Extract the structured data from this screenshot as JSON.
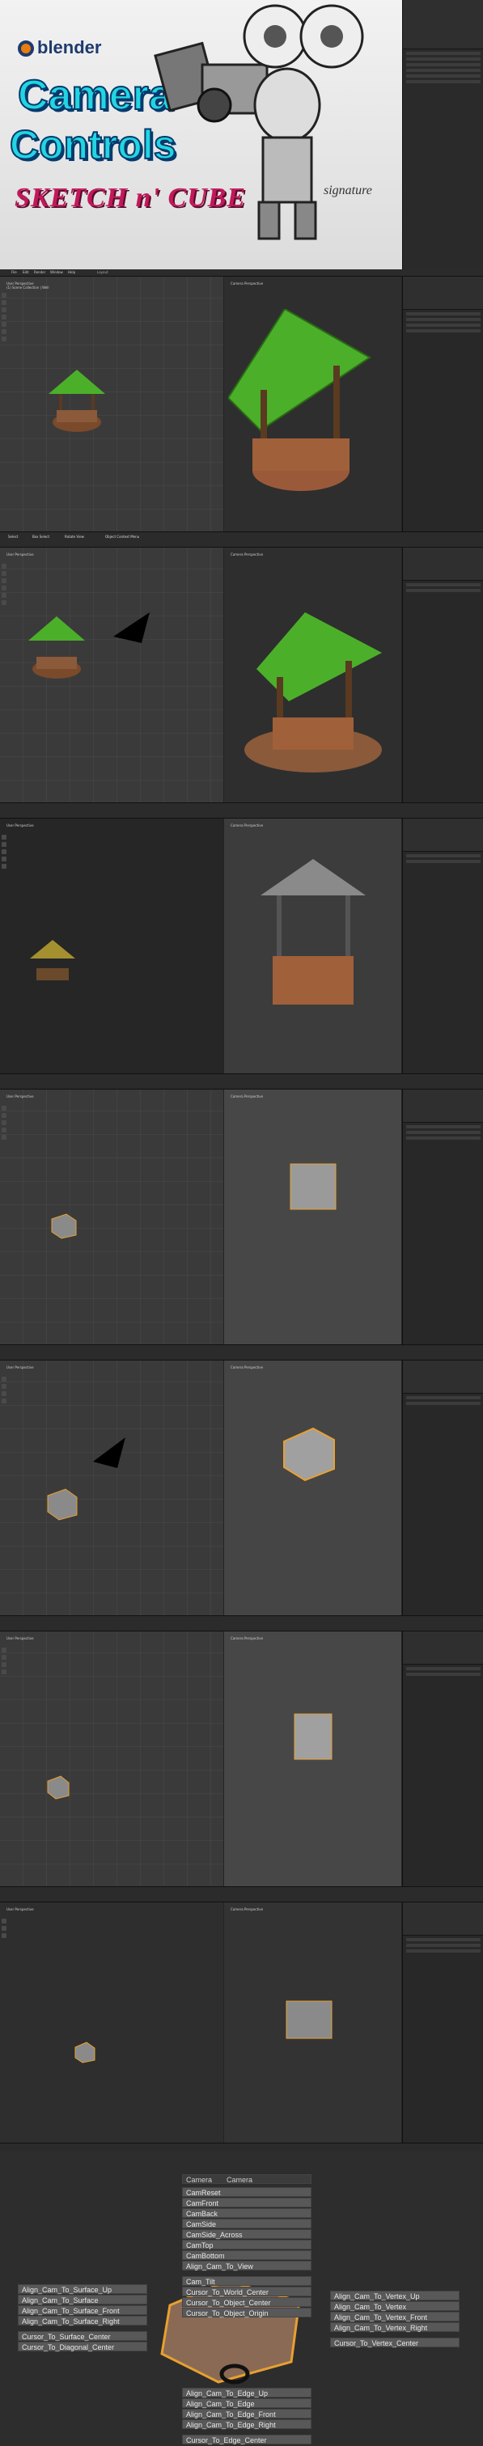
{
  "title_card": {
    "logo_text": "blender",
    "title_line1": "Camera",
    "title_line2": "Controls",
    "brand": "SKETCH n' CUBE"
  },
  "app": {
    "menu": [
      "File",
      "Edit",
      "Render",
      "Window",
      "Help"
    ],
    "workspace_tabs": [
      "Layout",
      "Modeling",
      "Sculpting",
      "UV Editing",
      "Texture Paint",
      "Shading",
      "Animation"
    ],
    "left_view_label_1": "User Perspective",
    "left_view_label_2": "(1) Scene Collection | Well",
    "right_view_label_1": "Camera Perspective",
    "right_view_label_2": "(1) Scene Collection | Cube",
    "status_select": "Select",
    "status_box": "Box Select",
    "status_rotate": "Rotate View",
    "status_menu": "Object Context Menu"
  },
  "camera_menu": {
    "header_label": "Camera",
    "header_value": "Camera",
    "center_items": [
      "CamReset",
      "CamFront",
      "CamBack",
      "CamSide",
      "CamSide_Across",
      "CamTop",
      "CamBottom",
      "Align_Cam_To_View",
      "",
      "Cam_Tilt",
      "Cursor_To_World_Center",
      "Cursor_To_Object_Center",
      "Cursor_To_Object_Origin"
    ],
    "left_items": [
      "Align_Cam_To_Surface_Up",
      "Align_Cam_To_Surface",
      "Align_Cam_To_Surface_Front",
      "Align_Cam_To_Surface_Right",
      "",
      "Cursor_To_Surface_Center",
      "Cursor_To_Diagonal_Center"
    ],
    "right_items": [
      "Align_Cam_To_Vertex_Up",
      "Align_Cam_To_Vertex",
      "Align_Cam_To_Vertex_Front",
      "Align_Cam_To_Vertex_Right",
      "",
      "Cursor_To_Vertex_Center"
    ],
    "bottom_items": [
      "Align_Cam_To_Edge_Up",
      "Align_Cam_To_Edge",
      "Align_Cam_To_Edge_Front",
      "Align_Cam_To_Edge_Right",
      "",
      "Cursor_To_Edge_Center"
    ]
  },
  "colors": {
    "title_cyan": "#23d5e0",
    "title_outline": "#063a6e",
    "brand_magenta": "#c2185b",
    "selection_orange": "#e8a030",
    "well_roof_green": "#4caf2a"
  }
}
